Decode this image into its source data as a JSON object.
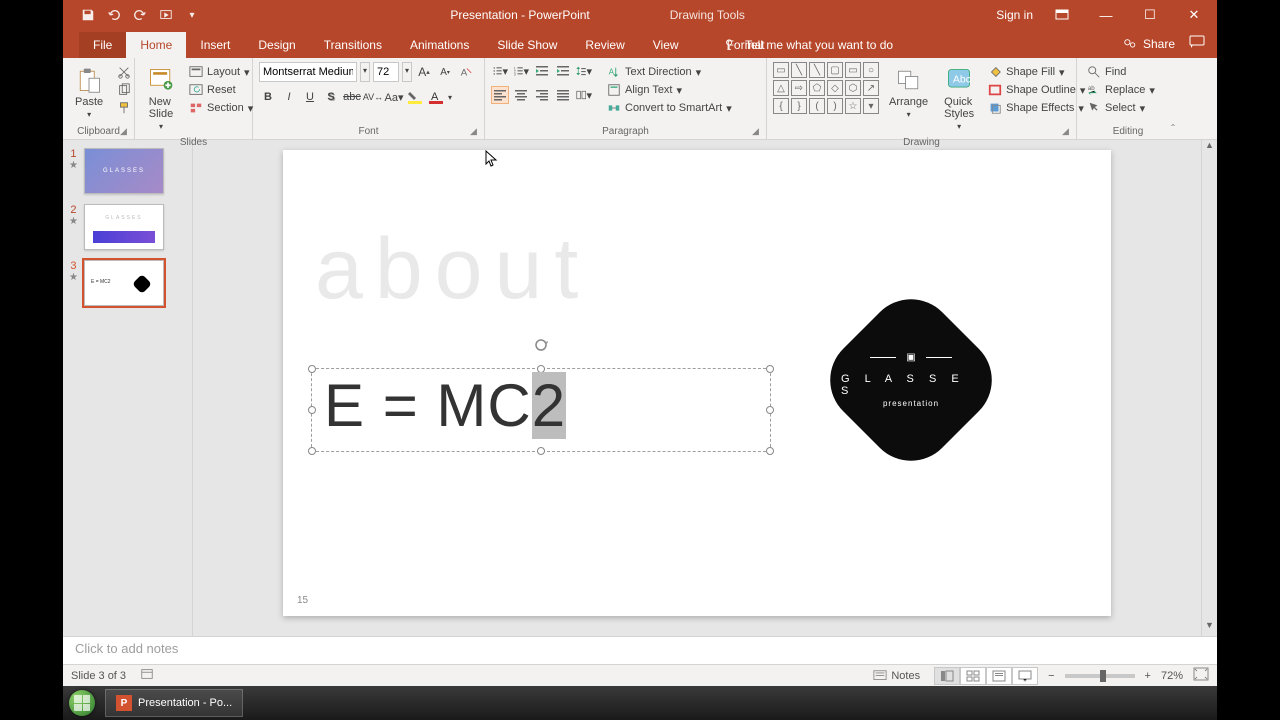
{
  "titlebar": {
    "title": "Presentation  -  PowerPoint",
    "context_tab": "Drawing Tools",
    "signin": "Sign in"
  },
  "tabs": {
    "file": "File",
    "home": "Home",
    "insert": "Insert",
    "design": "Design",
    "transitions": "Transitions",
    "animations": "Animations",
    "slideshow": "Slide Show",
    "review": "Review",
    "view": "View",
    "format": "Format",
    "tellme": "Tell me what you want to do",
    "share": "Share"
  },
  "ribbon": {
    "clipboard": {
      "paste": "Paste",
      "cut": "Cut",
      "copy": "Copy",
      "label": "Clipboard"
    },
    "slides": {
      "new": "New\nSlide",
      "layout": "Layout",
      "reset": "Reset",
      "section": "Section",
      "label": "Slides"
    },
    "font": {
      "name": "Montserrat Medium",
      "size": "72",
      "label": "Font"
    },
    "paragraph": {
      "textdir": "Text Direction",
      "align": "Align Text",
      "smartart": "Convert to SmartArt",
      "label": "Paragraph"
    },
    "drawing": {
      "arrange": "Arrange",
      "quick": "Quick\nStyles",
      "fill": "Shape Fill",
      "outline": "Shape Outline",
      "effects": "Shape Effects",
      "label": "Drawing"
    },
    "editing": {
      "find": "Find",
      "replace": "Replace",
      "select": "Select",
      "label": "Editing"
    }
  },
  "thumbs": {
    "t1": "GLASSES",
    "t2": "GLASSES",
    "t3": "E = MC2"
  },
  "slide": {
    "about": "about",
    "equation_pre": "E = MC",
    "equation_sel": "2",
    "logo_t1": "G L A S S E S",
    "logo_t2": "presentation",
    "pagenum": "15"
  },
  "notes": {
    "placeholder": "Click to add notes"
  },
  "status": {
    "left": "Slide 3 of 3",
    "notes": "Notes",
    "zoom": "72%"
  },
  "taskbar": {
    "item": "Presentation - Po..."
  }
}
